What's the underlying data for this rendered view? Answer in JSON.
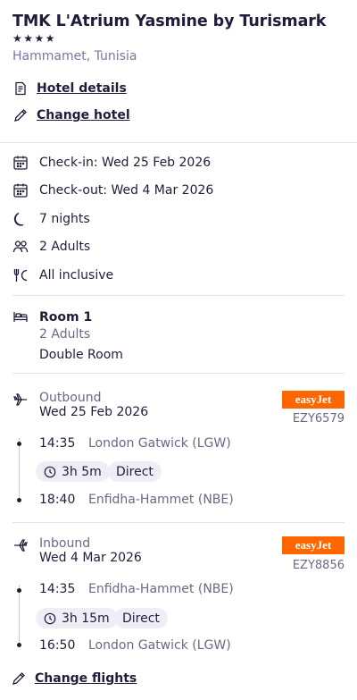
{
  "hotel": {
    "name": "TMK L'Atrium Yasmine by Turismark",
    "stars": "★★★★",
    "rating_stars": 4,
    "location": "Hammamet, Tunisia",
    "details_link": "Hotel details",
    "change_hotel_link": "Change hotel"
  },
  "stay": {
    "checkin": "Check-in: Wed 25 Feb 2026",
    "checkout": "Check-out: Wed 4 Mar 2026",
    "nights": "7 nights",
    "guests": "2 Adults",
    "board": "All inclusive"
  },
  "room": {
    "title": "Room 1",
    "guests": "2 Adults",
    "type": "Double Room"
  },
  "outbound": {
    "label": "Outbound",
    "date": "Wed 25 Feb 2026",
    "airline": "easyJet",
    "flight_no": "EZY6579",
    "depart_time": "14:35",
    "depart_airport": "London Gatwick (LGW)",
    "duration": "3h 5m",
    "stops": "Direct",
    "arrive_time": "18:40",
    "arrive_airport": "Enfidha-Hammet (NBE)"
  },
  "inbound": {
    "label": "Inbound",
    "date": "Wed 4 Mar 2026",
    "airline": "easyJet",
    "flight_no": "EZY8856",
    "depart_time": "14:35",
    "depart_airport": "Enfidha-Hammet (NBE)",
    "duration": "3h 15m",
    "stops": "Direct",
    "arrive_time": "16:50",
    "arrive_airport": "London Gatwick (LGW)"
  },
  "actions": {
    "change_flights": "Change flights"
  },
  "colors": {
    "text": "#1f1d3a",
    "muted": "#7a76a3",
    "easyjet": "#ff6600",
    "pill_bg": "#efeef7"
  }
}
